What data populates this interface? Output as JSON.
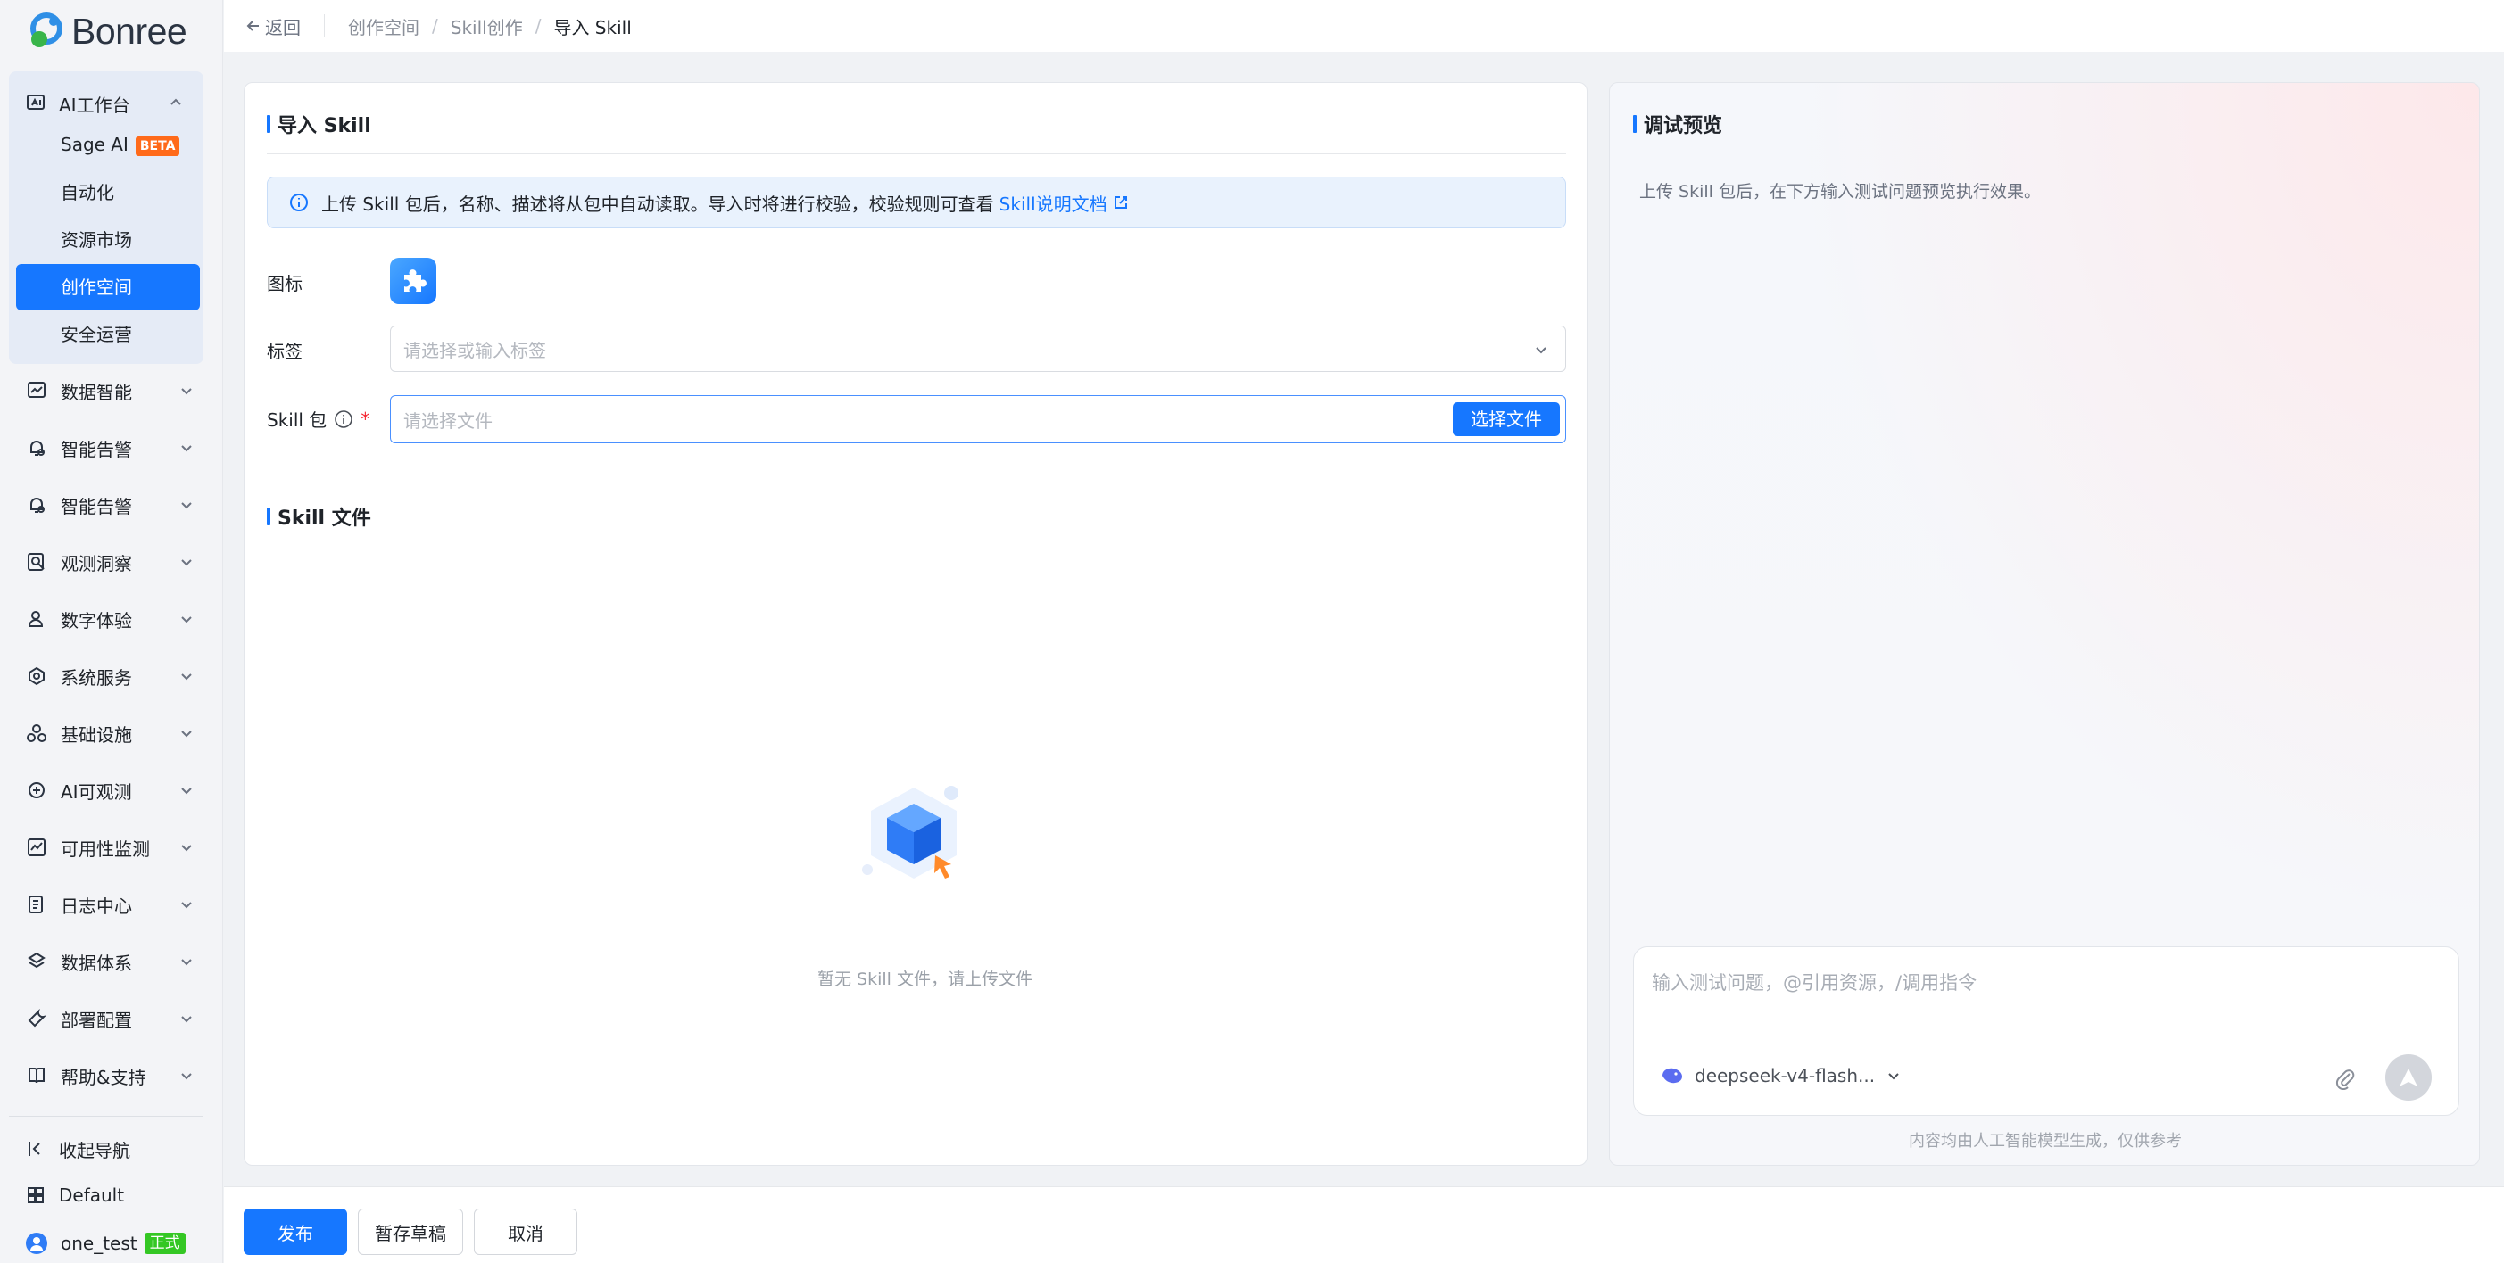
{
  "brand": {
    "logo_text": "Bonree"
  },
  "sidebar": {
    "workspace_group": {
      "label": "AI工作台",
      "items": [
        {
          "label": "Sage AI",
          "badge": "BETA"
        },
        {
          "label": "自动化"
        },
        {
          "label": "资源市场"
        },
        {
          "label": "创作空间",
          "active": true
        },
        {
          "label": "安全运营"
        }
      ]
    },
    "nav": [
      {
        "label": "数据智能",
        "icon": "chart-icon"
      },
      {
        "label": "智能告警",
        "icon": "alert-bell-icon"
      },
      {
        "label": "智能告警",
        "icon": "alert-bell-icon"
      },
      {
        "label": "观测洞察",
        "icon": "search-doc-icon"
      },
      {
        "label": "数字体验",
        "icon": "user-experience-icon"
      },
      {
        "label": "系统服务",
        "icon": "system-service-icon"
      },
      {
        "label": "基础设施",
        "icon": "infrastructure-icon"
      },
      {
        "label": "AI可观测",
        "icon": "ai-observe-icon"
      },
      {
        "label": "可用性监测",
        "icon": "availability-icon"
      },
      {
        "label": "日志中心",
        "icon": "log-icon"
      },
      {
        "label": "数据体系",
        "icon": "data-system-icon"
      },
      {
        "label": "部署配置",
        "icon": "deploy-icon"
      },
      {
        "label": "帮助&支持",
        "icon": "help-book-icon"
      }
    ],
    "collapse_label": "收起导航",
    "workspace_label": "Default",
    "user": {
      "name": "one_test",
      "badge": "正式"
    }
  },
  "topbar": {
    "back_label": "返回",
    "breadcrumb": [
      "创作空间",
      "Skill创作",
      "导入 Skill"
    ]
  },
  "import_panel": {
    "title": "导入 Skill",
    "info_text": "上传 Skill 包后，名称、描述将从包中自动读取。导入时将进行校验，校验规则可查看",
    "info_link": "Skill说明文档",
    "icon_label": "图标",
    "tag_label": "标签",
    "tag_placeholder": "请选择或输入标签",
    "package_label": "Skill 包",
    "package_placeholder": "请选择文件",
    "select_file_button": "选择文件",
    "files_title": "Skill 文件",
    "empty_text": "暂无 Skill 文件，请上传文件"
  },
  "preview_panel": {
    "title": "调试预览",
    "hint": "上传 Skill 包后，在下方输入测试问题预览执行效果。",
    "input_placeholder": "输入测试问题，@引用资源，/调用指令",
    "model_name": "deepseek-v4-flash...",
    "disclaimer": "内容均由人工智能模型生成，仅供参考"
  },
  "footer": {
    "publish_label": "发布",
    "draft_label": "暂存草稿",
    "cancel_label": "取消"
  },
  "colors": {
    "primary": "#1677ff",
    "beta_badge": "#ff6a1a",
    "prod_badge": "#34c724",
    "required": "#f5222d"
  }
}
